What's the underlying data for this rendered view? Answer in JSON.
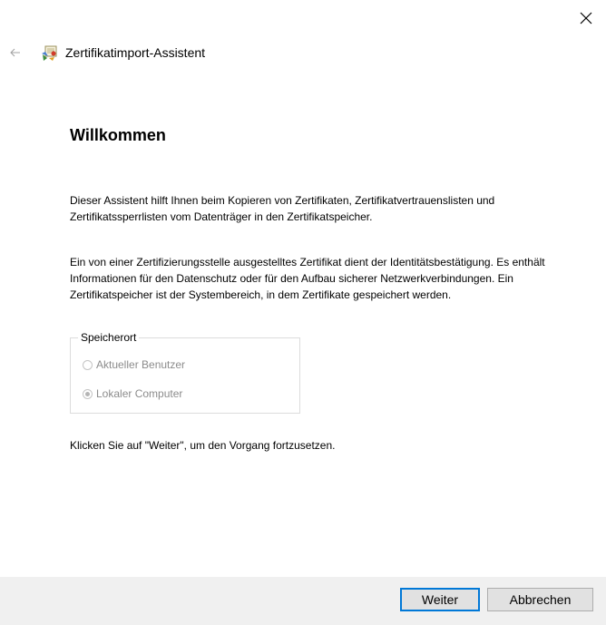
{
  "window": {
    "close_icon": "close-icon"
  },
  "header": {
    "back_icon": "back-arrow-icon",
    "wizard_icon": "certificate-wizard-icon",
    "title": "Zertifikatimport-Assistent"
  },
  "main": {
    "heading": "Willkommen",
    "paragraph_1": "Dieser Assistent hilft Ihnen beim Kopieren von Zertifikaten, Zertifikatvertrauenslisten und Zertifikatssperrlisten vom Datenträger in den Zertifikatspeicher.",
    "paragraph_2": "Ein von einer Zertifizierungsstelle ausgestelltes Zertifikat dient der Identitätsbestätigung. Es enthält Informationen für den Datenschutz oder für den Aufbau sicherer Netzwerkverbindungen. Ein Zertifikatspeicher ist der Systembereich, in dem Zertifikate gespeichert werden.",
    "store_location": {
      "legend": "Speicherort",
      "options": [
        {
          "label": "Aktueller Benutzer",
          "selected": false,
          "disabled": true
        },
        {
          "label": "Lokaler Computer",
          "selected": true,
          "disabled": true
        }
      ]
    },
    "paragraph_3": "Klicken Sie auf \"Weiter\", um den Vorgang fortzusetzen."
  },
  "footer": {
    "next_label": "Weiter",
    "cancel_label": "Abbrechen"
  },
  "colors": {
    "accent": "#0078d7",
    "footer_bg": "#f0f0f0",
    "disabled_text": "#8c8c8c"
  }
}
